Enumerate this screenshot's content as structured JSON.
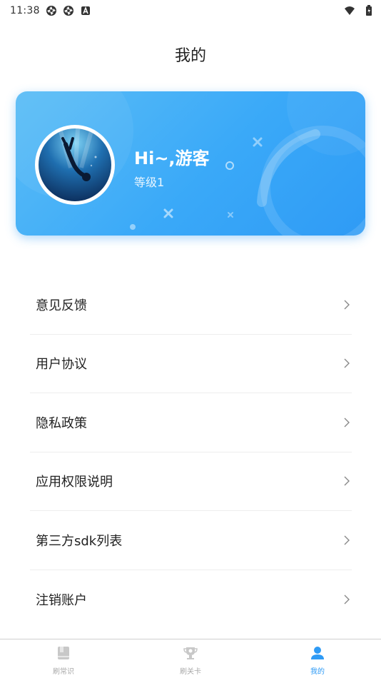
{
  "status_bar": {
    "time": "11:38",
    "icons": [
      "aperture-icon",
      "aperture-icon",
      "notification-a-icon"
    ],
    "right_icons": [
      "wifi-icon",
      "battery-icon"
    ]
  },
  "header": {
    "title": "我的"
  },
  "profile": {
    "greeting": "Hi~,游客",
    "level": "等级1",
    "avatar_icon": "diver-avatar"
  },
  "menu": {
    "items": [
      {
        "label": "意见反馈"
      },
      {
        "label": "用户协议"
      },
      {
        "label": "隐私政策"
      },
      {
        "label": "应用权限说明"
      },
      {
        "label": "第三方sdk列表"
      },
      {
        "label": "注销账户"
      }
    ]
  },
  "bottom_nav": {
    "tabs": [
      {
        "label": "刷常识",
        "icon": "book-icon",
        "active": false
      },
      {
        "label": "刷关卡",
        "icon": "trophy-icon",
        "active": false
      },
      {
        "label": "我的",
        "icon": "user-icon",
        "active": true
      }
    ]
  },
  "colors": {
    "accent": "#2f9bf5",
    "card_gradient_start": "#5bbdf6",
    "card_gradient_end": "#2f9bf5",
    "inactive_tab": "#a9a9a9"
  }
}
